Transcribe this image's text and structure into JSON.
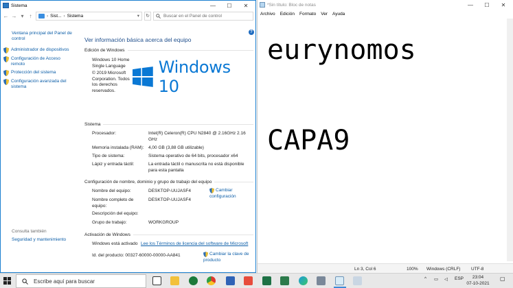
{
  "system": {
    "title": "Sistema",
    "address": [
      "Sist...",
      "Sistema"
    ],
    "search_placeholder": "Buscar en el Panel de control",
    "sidebar": {
      "home": "Ventana principal del Panel de control",
      "items": [
        "Administrador de dispositivos",
        "Configuración de Acceso remoto",
        "Protección del sistema",
        "Configuración avanzada del sistema"
      ],
      "see_also": "Consulta también",
      "security": "Seguridad y mantenimiento"
    },
    "heading": "Ver información básica acerca del equipo",
    "edition": {
      "section": "Edición de Windows",
      "name": "Windows 10 Home Single Language",
      "copyright": "© 2019 Microsoft Corporation. Todos los derechos reservados.",
      "logo_text": "Windows 10"
    },
    "system_section": {
      "section": "Sistema",
      "rows": [
        {
          "label": "Procesador:",
          "value": "Intel(R) Celeron(R) CPU  N2840  @ 2.16GHz   2.16 GHz"
        },
        {
          "label": "Memoria instalada (RAM):",
          "value": "4,00 GB (3,88 GB utilizable)"
        },
        {
          "label": "Tipo de sistema:",
          "value": "Sistema operativo de 64 bits, procesador x64"
        },
        {
          "label": "Lápiz y entrada táctil:",
          "value": "La entrada táctil o manuscrita no está disponible para esta pantalla"
        }
      ]
    },
    "computer_section": {
      "section": "Configuración de nombre, dominio y grupo de trabajo del equipo",
      "rows": [
        {
          "label": "Nombre del equipo:",
          "value": "DESKTOP-UUJASF4"
        },
        {
          "label": "Nombre completo de equipo:",
          "value": "DESKTOP-UUJASF4"
        },
        {
          "label": "Descripción del equipo:",
          "value": ""
        },
        {
          "label": "Grupo de trabajo:",
          "value": "WORKGROUP"
        }
      ],
      "change_link": "Cambiar configuración"
    },
    "activation": {
      "section": "Activación de Windows",
      "status": "Windows está activado",
      "license_link": "Lee los Términos de licencia del software de Microsoft",
      "product_label": "Id. del producto: 00327-60000-00000-AA841",
      "change_key": "Cambiar la clave de producto"
    }
  },
  "notepad": {
    "title": "*Sin título: Bloc de notas",
    "menu": [
      "Archivo",
      "Edición",
      "Formato",
      "Ver",
      "Ayuda"
    ],
    "line1": "eurynomos",
    "line2": "",
    "line3": "CAPA9",
    "status": {
      "position": "Ln 3, Col 6",
      "zoom": "100%",
      "eol": "Windows (CRLF)",
      "encoding": "UTF-8"
    }
  },
  "taskbar": {
    "search_placeholder": "Escribe aquí para buscar",
    "lang": "ESP",
    "time": "23:04",
    "date": "07-10-2021"
  },
  "window_controls": [
    "—",
    "☐",
    "✕"
  ]
}
